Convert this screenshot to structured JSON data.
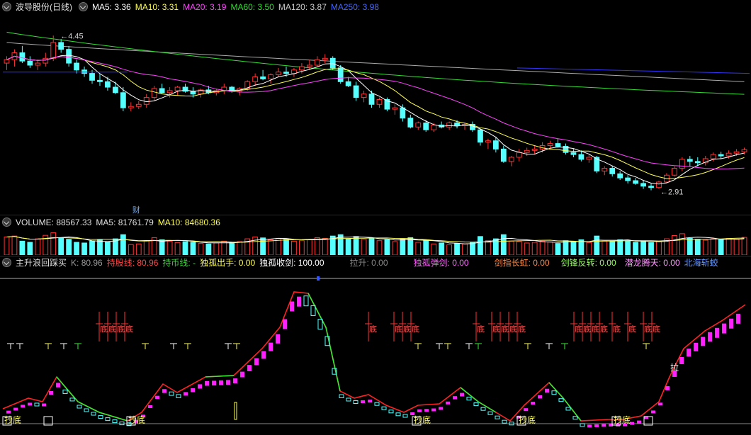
{
  "colors": {
    "up": "#ff3333",
    "down": "#55ffff",
    "ma5": "#ffffff",
    "ma10": "#ffff55",
    "ma20": "#ff44ff",
    "ma60": "#33dd33",
    "ma120": "#aaaaaa",
    "ma250": "#3333ff"
  },
  "price_header": {
    "title": "波导股份(日线)",
    "ma5": "MA5: 3.36",
    "ma10": "MA10: 3.31",
    "ma20": "MA20: 3.19",
    "ma60": "MA60: 3.50",
    "ma120": "MA120: 3.87",
    "ma250": "MA250: 3.98"
  },
  "volume_header": {
    "volume": "VOLUME: 88567.33",
    "ma5": "MA5: 81761.79",
    "ma10": "MA10: 84680.36"
  },
  "indicator_header": {
    "name": "主升浪回踩买",
    "k": "K: 80.96",
    "hold": "持股线: 80.96",
    "coin": "持币线: -",
    "dugu_out": "独孤出手: 0.00",
    "dugu_close": "独孤收剑: 100.00",
    "lasheng": "拉升: 0.00",
    "dugu_tan": "独孤弹剑: 0.00",
    "jianzhi": "剑指长虹: 0.00",
    "jianfeng": "剑锋反转: 0.00",
    "qianlong": "潜龙腾天: 0.00",
    "beihai": "北海斩蛟"
  },
  "annotations": {
    "high": "4.45",
    "low": "2.91",
    "cai": "财",
    "la": "拉",
    "di": "底",
    "chaodi": "抄底"
  },
  "chart_data": [
    {
      "type": "candlestick",
      "title": "波导股份(日线)",
      "ohlc": [
        [
          4.05,
          4.15,
          3.95,
          4.1
        ],
        [
          4.1,
          4.25,
          4.0,
          4.2
        ],
        [
          4.2,
          4.3,
          4.05,
          4.08
        ],
        [
          4.08,
          4.15,
          3.98,
          4.02
        ],
        [
          4.02,
          4.1,
          3.95,
          4.05
        ],
        [
          4.05,
          4.2,
          4.0,
          4.12
        ],
        [
          4.12,
          4.45,
          4.08,
          4.35
        ],
        [
          4.35,
          4.4,
          4.2,
          4.25
        ],
        [
          4.25,
          4.3,
          4.0,
          4.05
        ],
        [
          4.05,
          4.1,
          3.9,
          3.95
        ],
        [
          3.95,
          4.0,
          3.85,
          3.9
        ],
        [
          3.9,
          3.95,
          3.75,
          3.8
        ],
        [
          3.8,
          3.9,
          3.72,
          3.78
        ],
        [
          3.78,
          3.85,
          3.65,
          3.7
        ],
        [
          3.7,
          3.78,
          3.6,
          3.62
        ],
        [
          3.62,
          3.7,
          3.35,
          3.4
        ],
        [
          3.4,
          3.48,
          3.35,
          3.42
        ],
        [
          3.42,
          3.5,
          3.38,
          3.45
        ],
        [
          3.45,
          3.6,
          3.4,
          3.55
        ],
        [
          3.55,
          3.72,
          3.5,
          3.68
        ],
        [
          3.68,
          3.75,
          3.6,
          3.62
        ],
        [
          3.62,
          3.7,
          3.55,
          3.65
        ],
        [
          3.65,
          3.72,
          3.58,
          3.7
        ],
        [
          3.7,
          3.75,
          3.62,
          3.64
        ],
        [
          3.64,
          3.7,
          3.55,
          3.6
        ],
        [
          3.6,
          3.68,
          3.55,
          3.66
        ],
        [
          3.66,
          3.72,
          3.6,
          3.62
        ],
        [
          3.62,
          3.68,
          3.58,
          3.65
        ],
        [
          3.65,
          3.75,
          3.6,
          3.7
        ],
        [
          3.7,
          3.72,
          3.62,
          3.64
        ],
        [
          3.64,
          3.7,
          3.58,
          3.68
        ],
        [
          3.68,
          3.8,
          3.65,
          3.78
        ],
        [
          3.78,
          3.9,
          3.72,
          3.85
        ],
        [
          3.85,
          3.95,
          3.8,
          3.82
        ],
        [
          3.82,
          3.9,
          3.75,
          3.88
        ],
        [
          3.88,
          3.98,
          3.85,
          3.92
        ],
        [
          3.92,
          4.0,
          3.85,
          3.9
        ],
        [
          3.9,
          3.98,
          3.85,
          3.95
        ],
        [
          3.95,
          4.05,
          3.9,
          4.0
        ],
        [
          4.0,
          4.1,
          3.95,
          4.02
        ],
        [
          4.02,
          4.15,
          4.0,
          4.1
        ],
        [
          4.1,
          4.18,
          4.05,
          4.12
        ],
        [
          4.12,
          4.15,
          3.95,
          3.98
        ],
        [
          3.98,
          4.02,
          3.75,
          3.78
        ],
        [
          3.78,
          3.85,
          3.7,
          3.72
        ],
        [
          3.72,
          3.78,
          3.5,
          3.55
        ],
        [
          3.55,
          3.65,
          3.48,
          3.6
        ],
        [
          3.6,
          3.65,
          3.4,
          3.45
        ],
        [
          3.45,
          3.55,
          3.4,
          3.52
        ],
        [
          3.52,
          3.55,
          3.35,
          3.38
        ],
        [
          3.38,
          3.45,
          3.3,
          3.4
        ],
        [
          3.4,
          3.45,
          3.2,
          3.25
        ],
        [
          3.25,
          3.3,
          3.1,
          3.12
        ],
        [
          3.12,
          3.2,
          3.08,
          3.18
        ],
        [
          3.18,
          3.22,
          3.05,
          3.08
        ],
        [
          3.08,
          3.18,
          3.05,
          3.15
        ],
        [
          3.15,
          3.2,
          3.1,
          3.12
        ],
        [
          3.12,
          3.2,
          3.08,
          3.18
        ],
        [
          3.18,
          3.22,
          3.1,
          3.14
        ],
        [
          3.14,
          3.18,
          3.08,
          3.16
        ],
        [
          3.16,
          3.2,
          3.05,
          3.08
        ],
        [
          3.08,
          3.1,
          2.85,
          2.9
        ],
        [
          2.9,
          2.95,
          2.8,
          2.92
        ],
        [
          2.92,
          2.98,
          2.75,
          2.8
        ],
        [
          2.8,
          2.85,
          2.6,
          2.62
        ],
        [
          2.62,
          2.7,
          2.55,
          2.68
        ],
        [
          2.68,
          2.8,
          2.62,
          2.75
        ],
        [
          2.75,
          2.82,
          2.7,
          2.78
        ],
        [
          2.78,
          2.85,
          2.72,
          2.8
        ],
        [
          2.8,
          2.9,
          2.75,
          2.85
        ],
        [
          2.85,
          2.92,
          2.8,
          2.88
        ],
        [
          2.88,
          2.95,
          2.82,
          2.84
        ],
        [
          2.84,
          2.88,
          2.72,
          2.75
        ],
        [
          2.75,
          2.8,
          2.68,
          2.72
        ],
        [
          2.72,
          2.78,
          2.62,
          2.65
        ],
        [
          2.65,
          2.72,
          2.6,
          2.68
        ],
        [
          2.68,
          2.7,
          2.45,
          2.48
        ],
        [
          2.48,
          2.55,
          2.42,
          2.52
        ],
        [
          2.52,
          2.56,
          2.4,
          2.44
        ],
        [
          2.44,
          2.48,
          2.35,
          2.38
        ],
        [
          2.38,
          2.42,
          2.3,
          2.34
        ],
        [
          2.34,
          2.38,
          2.28,
          2.3
        ],
        [
          2.3,
          2.34,
          2.22,
          2.26
        ],
        [
          2.26,
          2.3,
          2.2,
          2.24
        ],
        [
          2.24,
          2.34,
          2.22,
          2.32
        ],
        [
          2.32,
          2.45,
          2.3,
          2.42
        ],
        [
          2.42,
          2.55,
          2.4,
          2.52
        ],
        [
          2.52,
          2.68,
          2.48,
          2.65
        ],
        [
          2.65,
          2.7,
          2.55,
          2.62
        ],
        [
          2.62,
          2.68,
          2.55,
          2.6
        ],
        [
          2.6,
          2.7,
          2.56,
          2.66
        ],
        [
          2.66,
          2.75,
          2.62,
          2.72
        ],
        [
          2.72,
          2.76,
          2.65,
          2.7
        ],
        [
          2.7,
          2.78,
          2.66,
          2.74
        ],
        [
          2.74,
          2.8,
          2.7,
          2.76
        ],
        [
          2.76,
          2.82,
          2.72,
          2.79
        ]
      ],
      "ylim": [
        2.0,
        4.7
      ]
    },
    {
      "type": "bar",
      "title": "VOLUME",
      "values": [
        78,
        82,
        60,
        55,
        70,
        85,
        96,
        72,
        68,
        55,
        52,
        60,
        65,
        58,
        70,
        88,
        45,
        48,
        62,
        75,
        66,
        60,
        54,
        58,
        55,
        50,
        48,
        52,
        60,
        55,
        58,
        70,
        78,
        74,
        66,
        72,
        68,
        60,
        62,
        66,
        75,
        72,
        82,
        88,
        70,
        80,
        68,
        72,
        62,
        66,
        58,
        70,
        75,
        55,
        62,
        48,
        52,
        44,
        50,
        48,
        55,
        80,
        62,
        70,
        88,
        60,
        58,
        52,
        55,
        60,
        56,
        50,
        62,
        58,
        66,
        54,
        82,
        60,
        58,
        66,
        62,
        55,
        60,
        54,
        58,
        70,
        84,
        92,
        72,
        68,
        64,
        70,
        66,
        72,
        68,
        76
      ],
      "ylim": [
        0,
        110
      ]
    }
  ]
}
